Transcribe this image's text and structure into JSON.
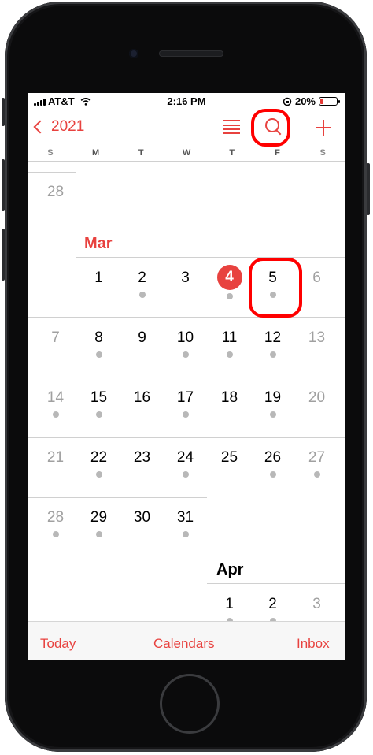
{
  "status": {
    "carrier": "AT&T",
    "time": "2:16 PM",
    "battery": "20%"
  },
  "nav": {
    "back_label": "2021"
  },
  "weekdays": [
    "S",
    "M",
    "T",
    "W",
    "T",
    "F",
    "S"
  ],
  "months": {
    "mar": "Mar",
    "apr": "Apr"
  },
  "calendar": {
    "feb_last": "28",
    "rows": [
      [
        "1",
        "2",
        "3",
        "4",
        "5",
        "6"
      ],
      [
        "7",
        "8",
        "9",
        "10",
        "11",
        "12",
        "13"
      ],
      [
        "14",
        "15",
        "16",
        "17",
        "18",
        "19",
        "20"
      ],
      [
        "21",
        "22",
        "23",
        "24",
        "25",
        "26",
        "27"
      ],
      [
        "28",
        "29",
        "30",
        "31"
      ]
    ],
    "apr_row": [
      "1",
      "2",
      "3"
    ]
  },
  "tabs": {
    "today": "Today",
    "calendars": "Calendars",
    "inbox": "Inbox"
  },
  "colors": {
    "accent": "#e8423f",
    "annotation": "#ff0000"
  }
}
